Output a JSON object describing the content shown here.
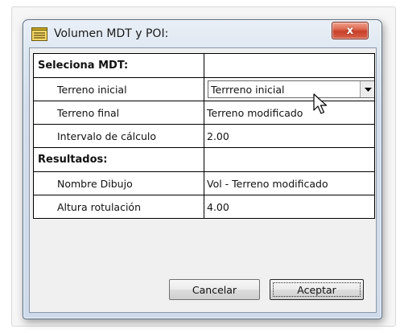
{
  "window": {
    "title": "Volumen MDT y POI:",
    "close_label": "x"
  },
  "sections": {
    "mdt": {
      "header": "Seleciona MDT:",
      "rows": [
        {
          "key": "Terreno inicial",
          "value": "Terrreno inicial",
          "control": "dropdown"
        },
        {
          "key": "Terreno final",
          "value": "Terreno modificado"
        },
        {
          "key": "Intervalo de cálculo",
          "value": "2.00"
        }
      ]
    },
    "results": {
      "header": "Resultados:",
      "rows": [
        {
          "key": "Nombre Dibujo",
          "value": "Vol - Terreno modificado"
        },
        {
          "key": "Altura rotulación",
          "value": "4.00"
        }
      ]
    }
  },
  "buttons": {
    "cancel": "Cancelar",
    "ok": "Aceptar"
  },
  "icons": {
    "title": "window-list-icon",
    "dropdown": "chevron-down-icon",
    "cursor": "mouse-pointer-icon"
  }
}
